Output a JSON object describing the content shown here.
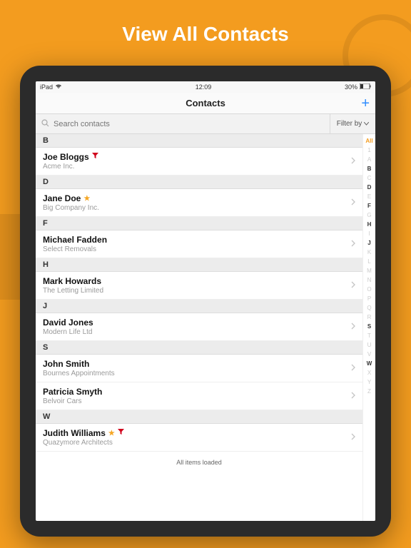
{
  "banner": "View All Contacts",
  "status": {
    "device": "iPad",
    "time": "12:09",
    "battery": "30%"
  },
  "nav": {
    "title": "Contacts",
    "add": "+"
  },
  "search": {
    "placeholder": "Search contacts"
  },
  "filter": {
    "label": "Filter by"
  },
  "footer": "All items loaded",
  "sections": [
    {
      "letter": "B",
      "rows": [
        {
          "name": "Joe Bloggs",
          "company": "Acme Inc.",
          "funnel": true,
          "star": false
        }
      ]
    },
    {
      "letter": "D",
      "rows": [
        {
          "name": "Jane Doe",
          "company": "Big Company Inc.",
          "funnel": false,
          "star": true
        }
      ]
    },
    {
      "letter": "F",
      "rows": [
        {
          "name": "Michael Fadden",
          "company": "Select Removals",
          "funnel": false,
          "star": false
        }
      ]
    },
    {
      "letter": "H",
      "rows": [
        {
          "name": "Mark Howards",
          "company": "The Letting Limited",
          "funnel": false,
          "star": false
        }
      ]
    },
    {
      "letter": "J",
      "rows": [
        {
          "name": "David Jones",
          "company": "Modern Life Ltd",
          "funnel": false,
          "star": false
        }
      ]
    },
    {
      "letter": "S",
      "rows": [
        {
          "name": "John Smith",
          "company": "Bournes Appointments",
          "funnel": false,
          "star": false
        },
        {
          "name": "Patricia Smyth",
          "company": "Belvoir Cars",
          "funnel": false,
          "star": false
        }
      ]
    },
    {
      "letter": "W",
      "rows": [
        {
          "name": "Judith Williams",
          "company": "Quazymore Architects",
          "funnel": true,
          "star": true
        }
      ]
    }
  ],
  "index": [
    "All",
    "1",
    "A",
    "B",
    "C",
    "D",
    "E",
    "F",
    "G",
    "H",
    "I",
    "J",
    "K",
    "L",
    "M",
    "N",
    "O",
    "P",
    "Q",
    "R",
    "S",
    "T",
    "U",
    "V",
    "W",
    "X",
    "Y",
    "Z"
  ],
  "indexActive": "All",
  "indexHas": [
    "B",
    "D",
    "F",
    "H",
    "J",
    "S",
    "W"
  ]
}
